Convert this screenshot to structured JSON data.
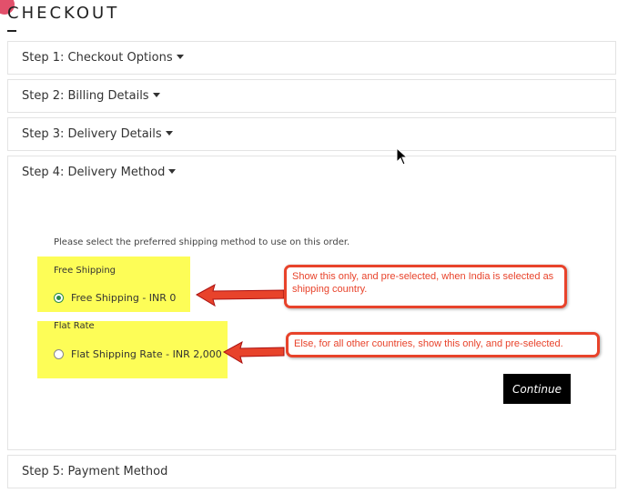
{
  "page": {
    "title": "CHECKOUT"
  },
  "steps": [
    {
      "label": "Step 1: Checkout Options"
    },
    {
      "label": "Step 2: Billing Details"
    },
    {
      "label": "Step 3: Delivery Details"
    },
    {
      "label": "Step 4: Delivery Method"
    },
    {
      "label": "Step 5: Payment Method"
    }
  ],
  "delivery_method": {
    "instruction": "Please select the preferred shipping method to use on this order.",
    "groups": [
      {
        "title": "Free Shipping",
        "option_label": "Free Shipping - INR 0",
        "selected": true
      },
      {
        "title": "Flat Rate",
        "option_label": "Flat Shipping Rate - INR 2,000",
        "selected": false
      }
    ],
    "continue_label": "Continue"
  },
  "annotations": [
    {
      "text": "Show this only, and pre-selected, when India is selected as shipping country."
    },
    {
      "text": "Else, for all other countries, show this only, and pre-selected."
    }
  ],
  "colors": {
    "highlight": "#fdfd57",
    "callout_red": "#e8432b",
    "radio_selected": "#2a8a4a",
    "button_bg": "#000000",
    "badge": "#e2506b"
  },
  "icons": {
    "step_toggle": "caret-down-icon",
    "pointer": "mouse-cursor-icon"
  }
}
